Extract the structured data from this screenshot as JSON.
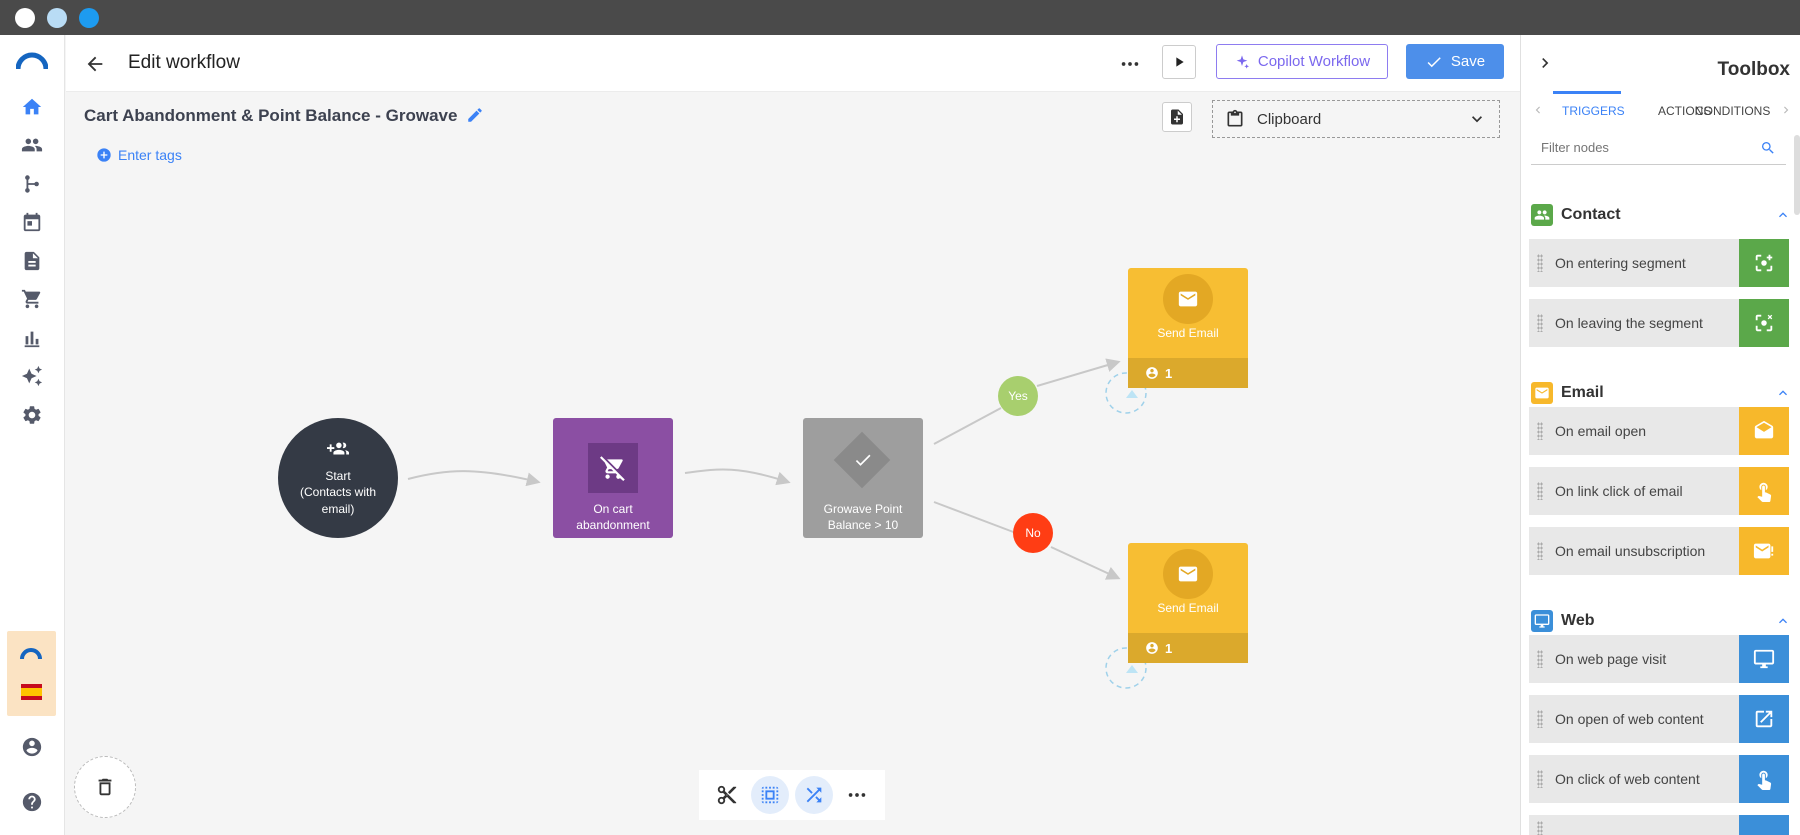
{
  "header": {
    "title": "Edit workflow",
    "copilot_label": "Copilot Workflow",
    "save_label": "Save"
  },
  "workflow": {
    "name": "Cart Abandonment & Point Balance - Growave",
    "tags_label": "Enter tags",
    "clipboard_label": "Clipboard"
  },
  "nodes": {
    "start_title": "Start",
    "start_sub": "(Contacts with email)",
    "cart_label": "On cart abandonment",
    "condition_label": "Growave Point Balance > 10",
    "yes_label": "Yes",
    "no_label": "No",
    "email1_label": "Send Email",
    "email1_count": "1",
    "email2_label": "Send Email",
    "email2_count": "1"
  },
  "toolbox": {
    "title": "Toolbox",
    "tabs": [
      "TRIGGERS",
      "ACTIONS",
      "CONDITIONS"
    ],
    "filter_placeholder": "Filter nodes",
    "sections": [
      {
        "name": "Contact",
        "color": "#5ba84a",
        "items": [
          "On entering segment",
          "On leaving the segment"
        ]
      },
      {
        "name": "Email",
        "color": "#f7b82b",
        "items": [
          "On email open",
          "On link click of email",
          "On email unsubscription"
        ]
      },
      {
        "name": "Web",
        "color": "#3b8fd9",
        "items": [
          "On web page visit",
          "On open of web content",
          "On click of web content"
        ]
      }
    ]
  },
  "colors": {
    "accent": "#3b82f6",
    "start_node": "#343a45",
    "cart_node": "#8b4fa3",
    "condition_node": "#9e9e9e",
    "email_node": "#f7be33",
    "yes": "#a8cf6e",
    "no": "#ff3d14"
  }
}
